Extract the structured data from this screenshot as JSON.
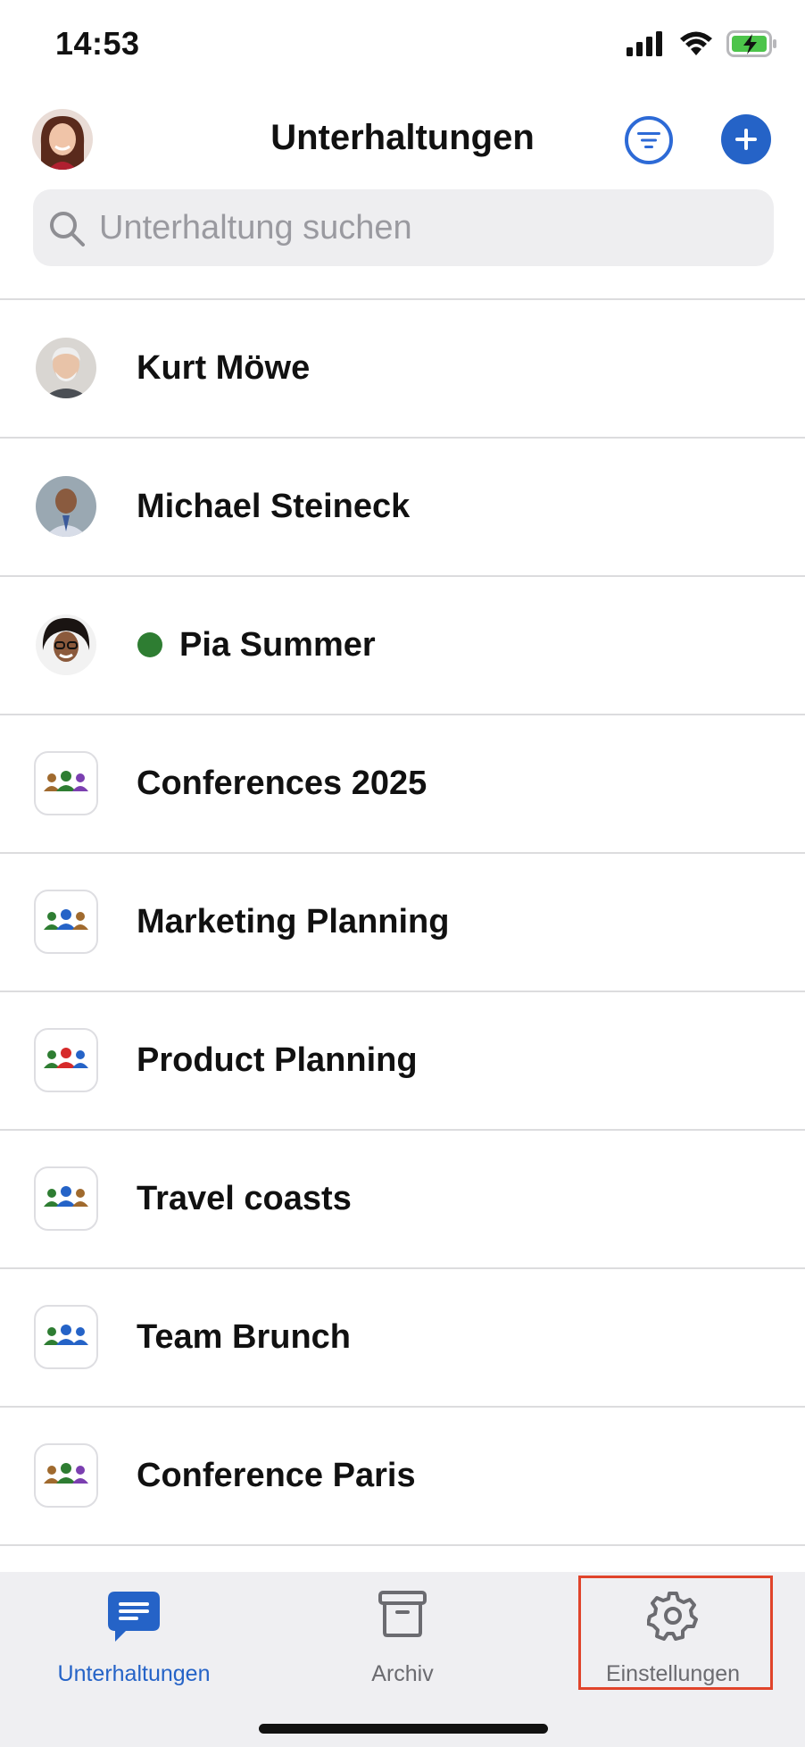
{
  "status": {
    "time": "14:53"
  },
  "header": {
    "title": "Unterhaltungen"
  },
  "search": {
    "placeholder": "Unterhaltung suchen"
  },
  "colors": {
    "accent": "#2563c7",
    "presence_online": "#2e7d32",
    "highlight": "#e0442b"
  },
  "conversations": [
    {
      "label": "Kurt Möwe",
      "kind": "person",
      "icon": "avatar"
    },
    {
      "label": "Michael Steineck",
      "kind": "person",
      "icon": "avatar"
    },
    {
      "label": "Pia Summer",
      "kind": "person",
      "icon": "avatar",
      "presence": "online"
    },
    {
      "label": "Conferences 2025",
      "kind": "group",
      "icon": "group-icon"
    },
    {
      "label": "Marketing Planning",
      "kind": "group",
      "icon": "group-icon"
    },
    {
      "label": "Product Planning",
      "kind": "group",
      "icon": "group-icon"
    },
    {
      "label": "Travel coasts",
      "kind": "group",
      "icon": "group-icon"
    },
    {
      "label": "Team Brunch",
      "kind": "group",
      "icon": "group-icon"
    },
    {
      "label": "Conference Paris",
      "kind": "group",
      "icon": "group-icon"
    }
  ],
  "tabs": [
    {
      "label": "Unterhaltungen",
      "icon": "chat-icon",
      "active": true
    },
    {
      "label": "Archiv",
      "icon": "archive-icon",
      "active": false
    },
    {
      "label": "Einstellungen",
      "icon": "gear-icon",
      "active": false,
      "highlighted": true
    }
  ]
}
